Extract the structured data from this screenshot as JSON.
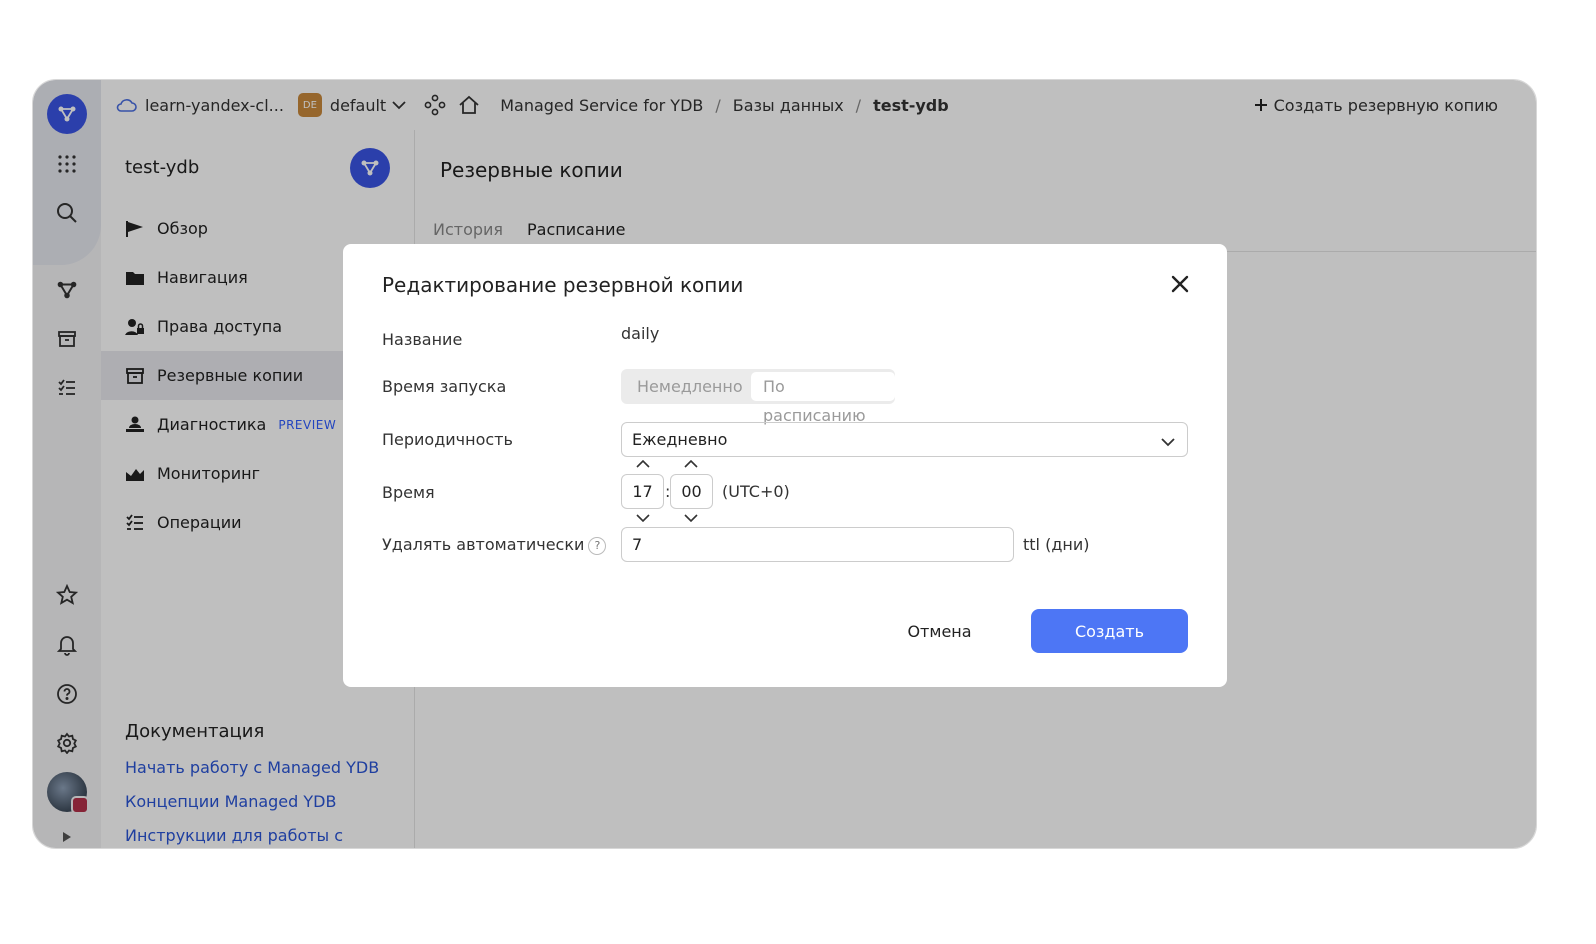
{
  "header": {
    "cloud_name": "learn-yandex-cl...",
    "folder_badge": "DE",
    "folder_name": "default",
    "service": "Managed Service for YDB",
    "section": "Базы данных",
    "current": "test-ydb",
    "separator": "/",
    "create_backup_label": "Создать резервную копию"
  },
  "sidebar": {
    "title": "test-ydb",
    "items": [
      {
        "label": "Обзор"
      },
      {
        "label": "Навигация"
      },
      {
        "label": "Права доступа"
      },
      {
        "label": "Резервные копии"
      },
      {
        "label": "Диагностика",
        "badge": "PREVIEW"
      },
      {
        "label": "Мониторинг"
      },
      {
        "label": "Операции"
      }
    ],
    "docs_title": "Документация",
    "docs_links": [
      "Начать работу с Managed YDB",
      "Концепции Managed YDB",
      "Инструкции для работы с Managed YDB"
    ]
  },
  "main": {
    "title": "Резервные копии",
    "tabs": [
      "История",
      "Расписание"
    ]
  },
  "modal": {
    "title": "Редактирование резервной копии",
    "name_label": "Название",
    "name_value": "daily",
    "start_label": "Время запуска",
    "start_options": [
      "Немедленно",
      "По расписанию"
    ],
    "period_label": "Периодичность",
    "period_value": "Ежедневно",
    "time_label": "Время",
    "hours": "17",
    "minutes": "00",
    "time_sep": ":",
    "timezone": "(UTC+0)",
    "autodelete_label": "Удалять автоматически",
    "help_glyph": "?",
    "autodelete_value": "7",
    "autodelete_unit": "ttl (дни)",
    "cancel_label": "Отмена",
    "create_label": "Создать"
  },
  "colors": {
    "accent": "#4d76f5",
    "brand": "#3a55e5",
    "link": "#2a55d6"
  }
}
